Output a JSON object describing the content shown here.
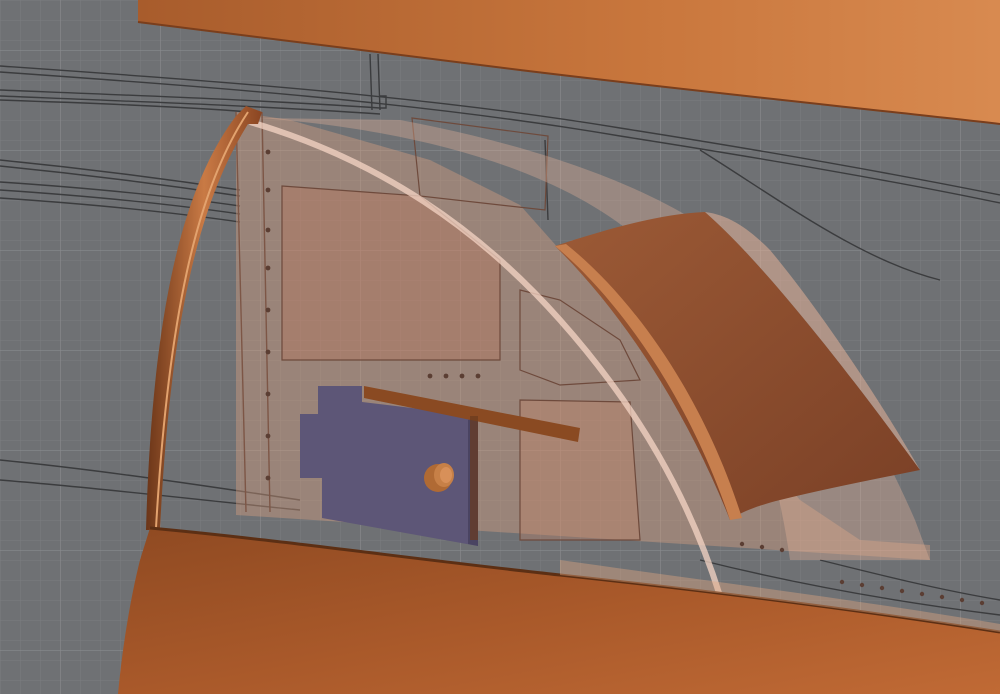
{
  "viewport": {
    "colors": {
      "background": "#6f7174",
      "grid_minor": "#7d7f82",
      "grid_major": "#8a8c8f",
      "blueprint_line": "#3a3b3d",
      "copper_dark": "#8a4a24",
      "copper_mid": "#b0652f",
      "copper_light": "#d98a52",
      "transparent_panel": "#e3a382",
      "purple_block": "#5d5677"
    }
  },
  "objects": [
    {
      "name": "upper-fuselage-shell"
    },
    {
      "name": "lower-fuselage-shell"
    },
    {
      "name": "canopy-frame-arc"
    },
    {
      "name": "canopy-glass-panel"
    },
    {
      "name": "cockpit-side-panel"
    },
    {
      "name": "instrument-cowl"
    },
    {
      "name": "control-bar"
    },
    {
      "name": "purple-console-block"
    },
    {
      "name": "control-knob"
    }
  ]
}
